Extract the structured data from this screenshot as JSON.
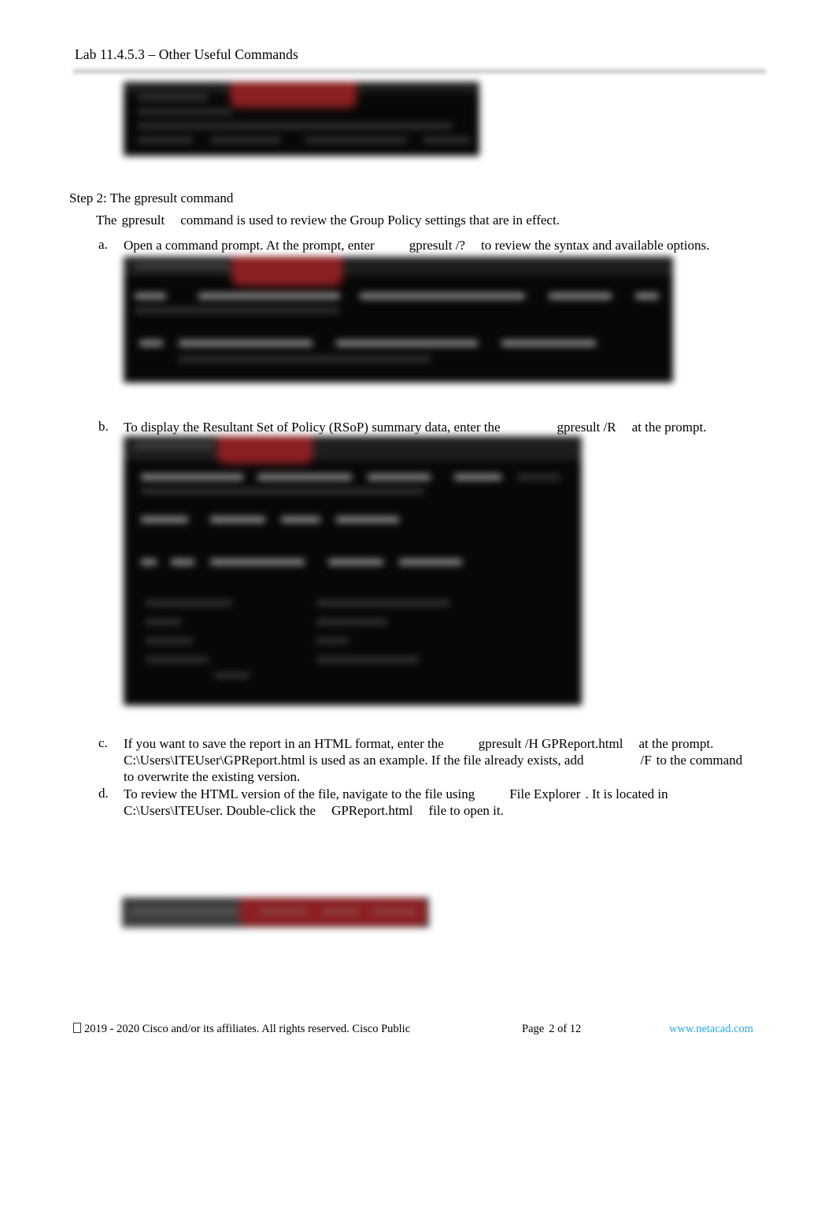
{
  "header": {
    "title": "Lab 11.4.5.3 – Other Useful Commands"
  },
  "body": {
    "step_title": "Step 2: The gpresult command",
    "intro": {
      "part1": "The",
      "command": "gpresult",
      "part2": "command is used to review the Group Policy settings that are in effect."
    },
    "items": [
      {
        "marker": "a.",
        "text1": "Open a command prompt. At the prompt, enter",
        "command1": "gpresult /?",
        "text2": "to review the syntax and available options."
      },
      {
        "marker": "b.",
        "text1": "To display the Resultant Set of Policy (RSoP) summary data, enter the",
        "command1": "gpresult /R",
        "text2": "at the prompt."
      },
      {
        "marker": "c.",
        "text1": "If you want to save the report in an HTML format, enter the",
        "command1": "gpresult /H GPReport.html",
        "text2": "at the prompt.",
        "line2a": "C:\\Users\\ITEUser\\GPReport.html is used as an example. If the file already exists, add",
        "command2": "/F",
        "line2b": "to the command",
        "line3": "to overwrite the existing version."
      },
      {
        "marker": "d.",
        "text1": "To review the HTML version of the file, navigate to the file using",
        "command1": "File Explorer",
        "text2": ". It is located in",
        "line2a": "C:\\Users\\ITEUser. Double-click the",
        "command2": "GPReport.html",
        "line2b": "file to open it."
      }
    ]
  },
  "screenshots": [
    {
      "name": "command-prompt-screenshot-top",
      "caption": ""
    },
    {
      "name": "gpresult-help-screenshot",
      "caption": ""
    },
    {
      "name": "gpresult-rsop-screenshot",
      "caption": ""
    },
    {
      "name": "gpresult-html-screenshot",
      "caption": ""
    }
  ],
  "footer": {
    "copyright": "2019 - 2020 Cisco and/or its affiliates. All rights reserved. Cisco Public",
    "page_label": "Page",
    "page_number": "2",
    "page_of": "of",
    "page_total": "12",
    "link": "www.netacad.com"
  },
  "colors": {
    "link": "#29ABE2",
    "highlight": "#8c1f22",
    "text": "#000000",
    "page_background": "#ffffff"
  }
}
